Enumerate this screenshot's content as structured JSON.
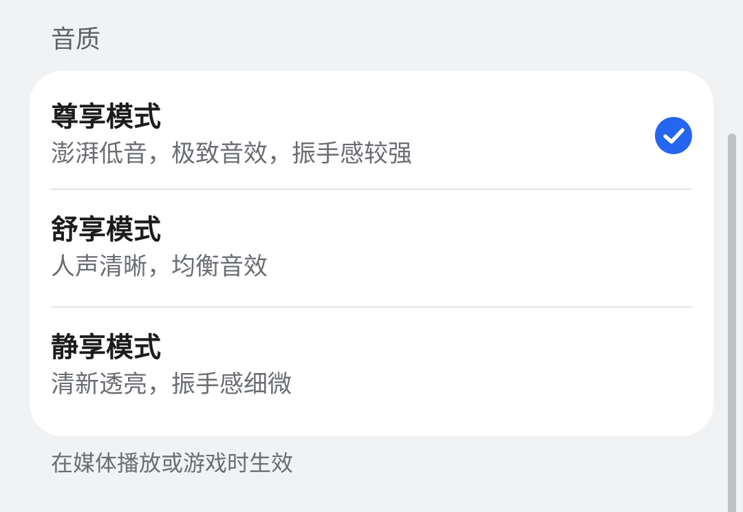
{
  "section": {
    "title": "音质"
  },
  "options": [
    {
      "title": "尊享模式",
      "description": "澎湃低音，极致音效，振手感较强",
      "selected": true
    },
    {
      "title": "舒享模式",
      "description": "人声清晰，均衡音效",
      "selected": false
    },
    {
      "title": "静享模式",
      "description": "清新透亮，振手感细微",
      "selected": false
    }
  ],
  "footer": {
    "note": "在媒体播放或游戏时生效"
  },
  "icons": {
    "selected": "check-circle-icon"
  },
  "colors": {
    "accent": "#2566f0",
    "background": "#f1f2f4",
    "card": "#ffffff"
  }
}
